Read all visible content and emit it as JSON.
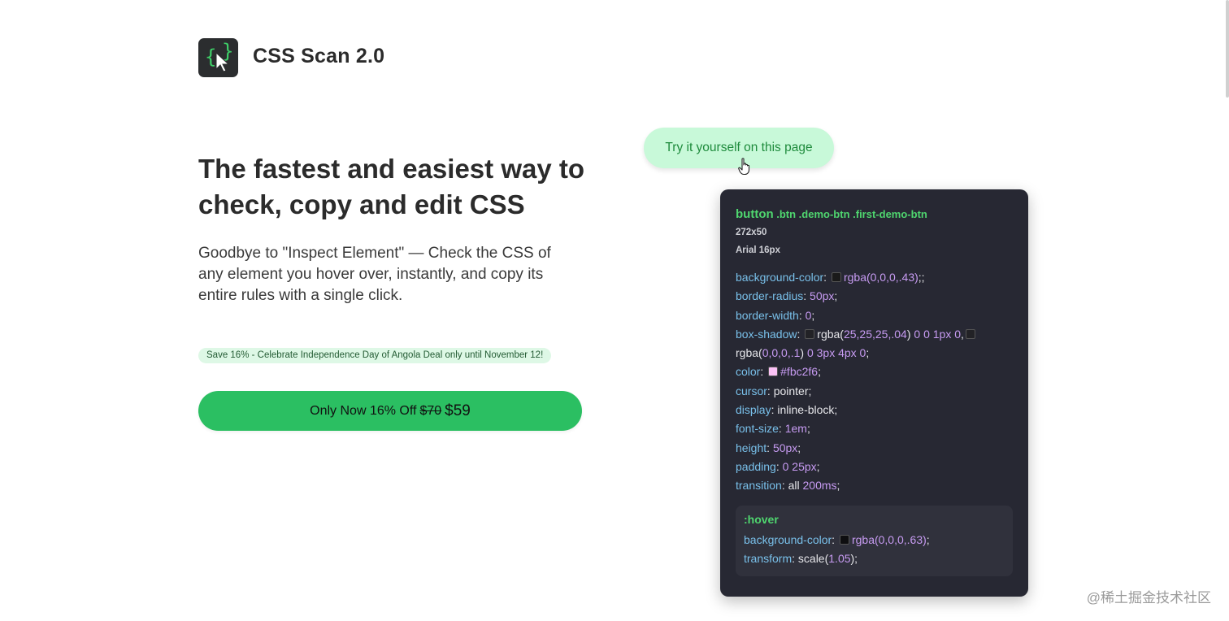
{
  "brand": {
    "name": "CSS Scan 2.0"
  },
  "hero": {
    "headline": "The fastest and easiest way to check, copy and edit CSS",
    "subtext": "Goodbye to \"Inspect Element\" — Check the CSS of any element you hover over, instantly, and copy its entire rules with a single click."
  },
  "promo": {
    "badge": "Save 16% - Celebrate Independence Day of Angola Deal only until November 12!"
  },
  "buy": {
    "label": "Only Now 16% Off",
    "old_price": "$70",
    "new_price": "$59"
  },
  "demo": {
    "label": "Try it yourself on this page"
  },
  "inspector": {
    "tag": "button",
    "classes": " .btn .demo-btn .first-demo-btn",
    "size": "272x50",
    "font": "Arial 16px",
    "rules": [
      {
        "prop": "background-color",
        "parts": [
          {
            "t": "swatch",
            "c": "#1a1a1a"
          },
          {
            "t": "num",
            "v": "rgba(0,0,0,.43)"
          },
          {
            "t": "txt",
            "v": ";;"
          }
        ]
      },
      {
        "prop": "border-radius",
        "parts": [
          {
            "t": "num",
            "v": "50px"
          },
          {
            "t": "txt",
            "v": ";"
          }
        ]
      },
      {
        "prop": "border-width",
        "parts": [
          {
            "t": "num",
            "v": "0"
          },
          {
            "t": "txt",
            "v": ";"
          }
        ]
      },
      {
        "prop": "box-shadow",
        "parts": [
          {
            "t": "swatch",
            "c": "#222226"
          },
          {
            "t": "txt",
            "v": "rgba("
          },
          {
            "t": "num",
            "v": "25,25,25,.04"
          },
          {
            "t": "txt",
            "v": ") "
          },
          {
            "t": "num",
            "v": "0 0 1px 0"
          },
          {
            "t": "txt",
            "v": ","
          },
          {
            "t": "swatch",
            "c": "#222226"
          },
          {
            "t": "txt",
            "v": "rgba("
          },
          {
            "t": "num",
            "v": "0,0,0,.1"
          },
          {
            "t": "txt",
            "v": ") "
          },
          {
            "t": "num",
            "v": "0 3px 4px 0"
          },
          {
            "t": "txt",
            "v": ";"
          }
        ]
      },
      {
        "prop": "color",
        "parts": [
          {
            "t": "swatch",
            "c": "#fbc2f6"
          },
          {
            "t": "num",
            "v": "#fbc2f6"
          },
          {
            "t": "txt",
            "v": ";"
          }
        ]
      },
      {
        "prop": "cursor",
        "parts": [
          {
            "t": "txt",
            "v": "pointer;"
          }
        ]
      },
      {
        "prop": "display",
        "parts": [
          {
            "t": "txt",
            "v": "inline-block;"
          }
        ]
      },
      {
        "prop": "font-size",
        "parts": [
          {
            "t": "num",
            "v": "1em"
          },
          {
            "t": "txt",
            "v": ";"
          }
        ]
      },
      {
        "prop": "height",
        "parts": [
          {
            "t": "num",
            "v": "50px"
          },
          {
            "t": "txt",
            "v": ";"
          }
        ]
      },
      {
        "prop": "padding",
        "parts": [
          {
            "t": "num",
            "v": "0 25px"
          },
          {
            "t": "txt",
            "v": ";"
          }
        ]
      },
      {
        "prop": "transition",
        "parts": [
          {
            "t": "txt",
            "v": "all "
          },
          {
            "t": "num",
            "v": "200ms"
          },
          {
            "t": "txt",
            "v": ";"
          }
        ]
      }
    ],
    "hover": {
      "title": ":hover",
      "rules": [
        {
          "prop": "background-color",
          "parts": [
            {
              "t": "swatch",
              "c": "#0e0e10"
            },
            {
              "t": "num",
              "v": "rgba(0,0,0,.63)"
            },
            {
              "t": "txt",
              "v": ";"
            }
          ]
        },
        {
          "prop": "transform",
          "parts": [
            {
              "t": "txt",
              "v": "scale("
            },
            {
              "t": "num",
              "v": "1.05"
            },
            {
              "t": "txt",
              "v": ");"
            }
          ]
        }
      ]
    }
  },
  "watermark": "@稀土掘金技术社区",
  "colors": {
    "accent_green": "#2bbf62",
    "demo_bg": "#c8f9d9",
    "panel_bg": "#272833"
  },
  "icons": {
    "logo": "braces-cursor-icon",
    "pointer": "hand-pointer-icon"
  }
}
